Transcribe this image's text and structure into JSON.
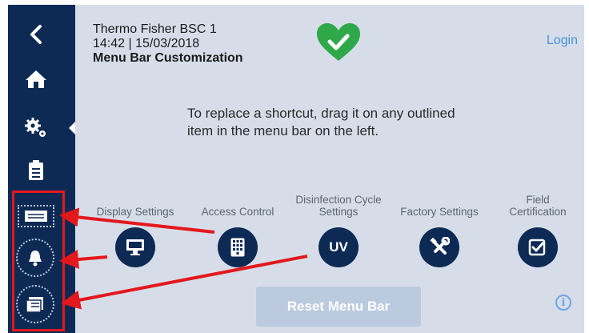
{
  "header": {
    "device_name": "Thermo Fisher BSC 1",
    "datetime": "14:42 | 15/03/2018",
    "screen_title": "Menu Bar Customization",
    "login_label": "Login",
    "status_icon": "heart-check-icon"
  },
  "instruction": "To replace a shortcut, drag it on any outlined item in the menu bar on the left.",
  "options": [
    {
      "label": "Display Settings",
      "icon": "monitor-icon"
    },
    {
      "label": "Access Control",
      "icon": "keypad-icon"
    },
    {
      "label": "Disinfection Cycle Settings",
      "icon_text": "UV"
    },
    {
      "label": "Factory Settings",
      "icon": "tools-icon"
    },
    {
      "label": "Field Certification",
      "icon": "checkbox-icon"
    }
  ],
  "reset_label": "Reset Menu Bar",
  "info_label": "i",
  "sidebar": {
    "items": [
      "back-icon",
      "home-icon",
      "settings-icon",
      "logbook-icon",
      "display-shortcut-icon",
      "alarm-shortcut-icon",
      "folder-shortcut-icon"
    ]
  },
  "colors": {
    "sidebar": "#0d2a55",
    "main_bg": "#d6dde9",
    "accent": "#4a90d9",
    "status_green": "#2fa84a",
    "highlight_red": "#e3181c"
  }
}
